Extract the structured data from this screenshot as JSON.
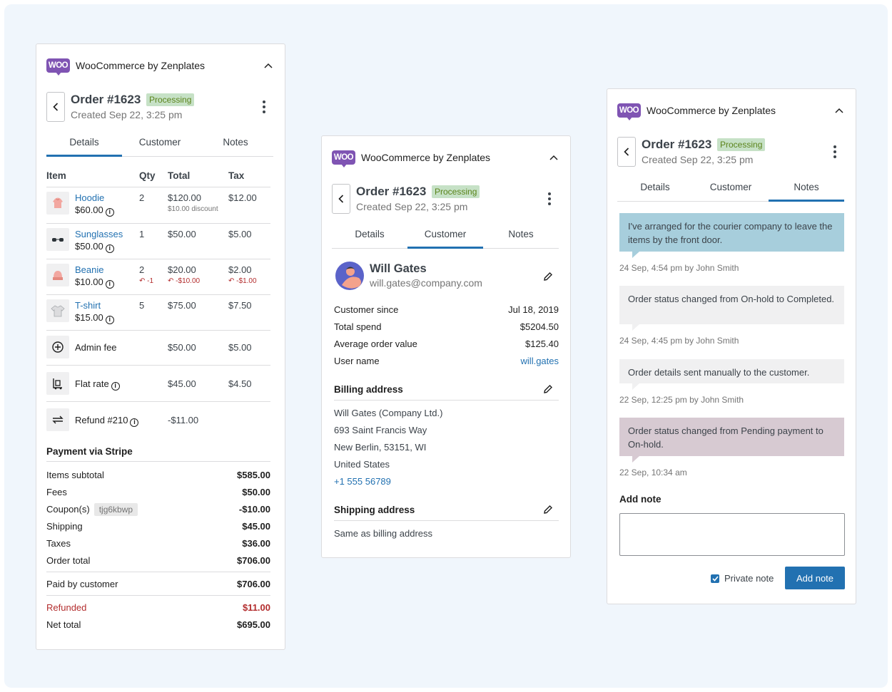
{
  "common": {
    "logo_text": "WOO",
    "panel_title": "WooCommerce by Zenplates",
    "order_title": "Order #1623",
    "status": "Processing",
    "created": "Created Sep 22, 3:25 pm",
    "tabs": [
      "Details",
      "Customer",
      "Notes"
    ]
  },
  "details": {
    "headers": {
      "item": "Item",
      "qty": "Qty",
      "total": "Total",
      "tax": "Tax"
    },
    "items": [
      {
        "name": "Hoodie",
        "price": "$60.00",
        "qty": "2",
        "total": "$120.00",
        "note": "$10.00 discount",
        "tax": "$12.00",
        "icon": "hoodie-icon"
      },
      {
        "name": "Sunglasses",
        "price": "$50.00",
        "qty": "1",
        "total": "$50.00",
        "tax": "$5.00",
        "icon": "sunglasses-icon"
      },
      {
        "name": "Beanie",
        "price": "$10.00",
        "qty": "2",
        "qty_refund": "-1",
        "total": "$20.00",
        "total_refund": "-$10.00",
        "tax": "$2.00",
        "tax_refund": "-$1.00",
        "icon": "beanie-icon"
      },
      {
        "name": "T-shirt",
        "price": "$15.00",
        "qty": "5",
        "total": "$75.00",
        "tax": "$7.50",
        "icon": "tshirt-icon"
      }
    ],
    "fees": [
      {
        "name": "Admin fee",
        "total": "$50.00",
        "tax": "$5.00",
        "icon": "plus-circle-icon"
      },
      {
        "name": "Flat rate",
        "total": "$45.00",
        "tax": "$4.50",
        "icon": "shipping-icon"
      },
      {
        "name": "Refund #210",
        "total": "-$11.00",
        "tax": "",
        "icon": "refund-icon"
      }
    ],
    "payment_title": "Payment via Stripe",
    "coupon_code": "tjg6kbwp",
    "summary": [
      {
        "label": "Items subtotal",
        "value": "$585.00"
      },
      {
        "label": "Fees",
        "value": "$50.00"
      },
      {
        "label": "Coupon(s)",
        "value": "-$10.00"
      },
      {
        "label": "Shipping",
        "value": "$45.00"
      },
      {
        "label": "Taxes",
        "value": "$36.00"
      },
      {
        "label": "Order total",
        "value": "$706.00"
      }
    ],
    "paid": {
      "label": "Paid by customer",
      "value": "$706.00"
    },
    "refunded": {
      "label": "Refunded",
      "value": "$11.00"
    },
    "net": {
      "label": "Net total",
      "value": "$695.00"
    },
    "refund_color": "#b32d2e"
  },
  "customer": {
    "name": "Will Gates",
    "email": "will.gates@company.com",
    "stats": [
      {
        "label": "Customer since",
        "value": "Jul 18, 2019"
      },
      {
        "label": "Total spend",
        "value": "$5204.50"
      },
      {
        "label": "Average order value",
        "value": "$125.40"
      },
      {
        "label": "User name",
        "value": "will.gates"
      }
    ],
    "billing_title": "Billing address",
    "billing_lines": [
      "Will Gates (Company Ltd.)",
      "693 Saint Francis Way",
      "New Berlin, 53151, WI",
      "United States"
    ],
    "phone": "+1 555 56789",
    "shipping_title": "Shipping address",
    "shipping_text": "Same as billing address"
  },
  "notes": {
    "items": [
      {
        "text": "I've arranged for the courier company to leave the items by the front door.",
        "meta": "24 Sep, 4:54 pm by John Smith",
        "color": "#a7cedc"
      },
      {
        "text": "Order status changed from On-hold to Completed.",
        "meta": "24 Sep, 4:45 pm by John Smith",
        "color": "#f0f0f1"
      },
      {
        "text": "Order details sent manually to the customer.",
        "meta": "22 Sep, 12:25 pm by John Smith",
        "color": "#f0f0f1"
      },
      {
        "text": "Order status changed from Pending payment to On-hold.",
        "meta": "22 Sep, 10:34 am",
        "color": "#d7cad2"
      }
    ],
    "add_note_label": "Add note",
    "note_value": "",
    "private_label": "Private note",
    "private_checked": true,
    "submit_label": "Add note",
    "accent": "#2271b1"
  }
}
